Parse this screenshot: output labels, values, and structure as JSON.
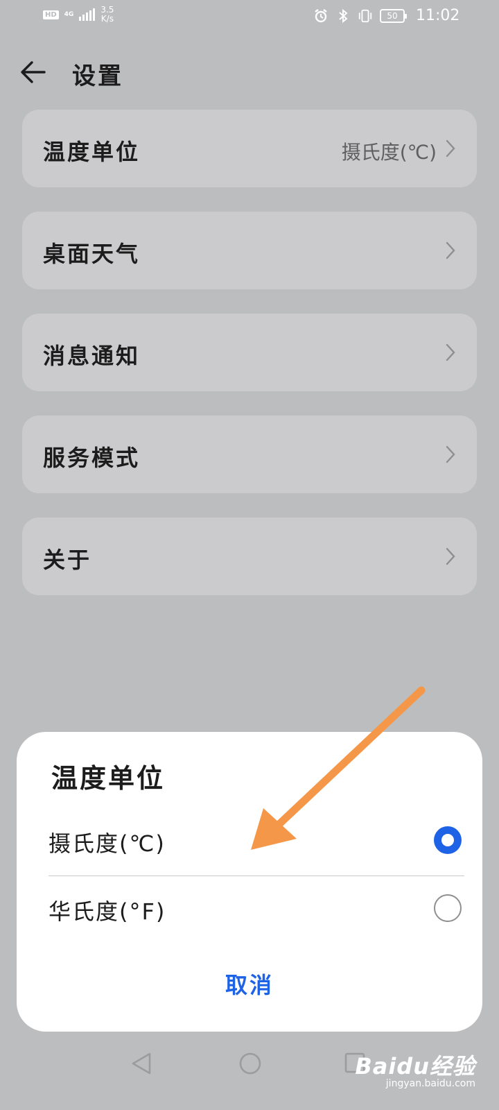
{
  "status_bar": {
    "hd": "HD",
    "network": "4G",
    "speed_value": "3.5",
    "speed_unit": "K/s",
    "battery": "50",
    "time": "11:02"
  },
  "header": {
    "title": "设置"
  },
  "settings": {
    "items": [
      {
        "label": "温度单位",
        "value": "摄氏度(℃)"
      },
      {
        "label": "桌面天气",
        "value": ""
      },
      {
        "label": "消息通知",
        "value": ""
      },
      {
        "label": "服务模式",
        "value": ""
      },
      {
        "label": "关于",
        "value": ""
      }
    ]
  },
  "dialog": {
    "title": "温度单位",
    "options": [
      {
        "label": "摄氏度(℃)",
        "selected": true
      },
      {
        "label": "华氏度(°F)",
        "selected": false
      }
    ],
    "cancel_label": "取消"
  },
  "colors": {
    "accent": "#1e62e6",
    "annotation_arrow": "#f59748",
    "background_dim": "#bcbdbf",
    "card": "#cbcbcd"
  },
  "watermark": {
    "logo": "Baidu经验",
    "url": "jingyan.baidu.com"
  }
}
